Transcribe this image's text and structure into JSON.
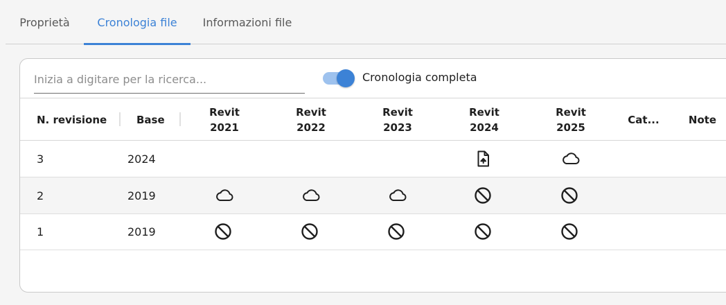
{
  "tabs": [
    {
      "label": "Proprietà",
      "active": false
    },
    {
      "label": "Cronologia file",
      "active": true
    },
    {
      "label": "Informazioni file",
      "active": false
    }
  ],
  "search": {
    "placeholder": "Inizia a digitare per la ricerca..."
  },
  "toggle": {
    "label": "Cronologia completa",
    "checked": true
  },
  "colors": {
    "accent": "#3c82d6",
    "accent_light": "#9ec2ee"
  },
  "table": {
    "columns": {
      "revision": "N. revisione",
      "base": "Base",
      "revit2021": {
        "line1": "Revit",
        "line2": "2021"
      },
      "revit2022": {
        "line1": "Revit",
        "line2": "2022"
      },
      "revit2023": {
        "line1": "Revit",
        "line2": "2023"
      },
      "revit2024": {
        "line1": "Revit",
        "line2": "2024"
      },
      "revit2025": {
        "line1": "Revit",
        "line2": "2025"
      },
      "category": "Cat...",
      "notes": "Note"
    },
    "rows": [
      {
        "revision": "3",
        "base": "2024",
        "status": [
          "",
          "",
          "",
          "file-upload-icon",
          "cloud-icon"
        ]
      },
      {
        "revision": "2",
        "base": "2019",
        "status": [
          "cloud-icon",
          "cloud-icon",
          "cloud-icon",
          "block-icon",
          "block-icon"
        ]
      },
      {
        "revision": "1",
        "base": "2019",
        "status": [
          "block-icon",
          "block-icon",
          "block-icon",
          "block-icon",
          "block-icon"
        ]
      }
    ]
  }
}
